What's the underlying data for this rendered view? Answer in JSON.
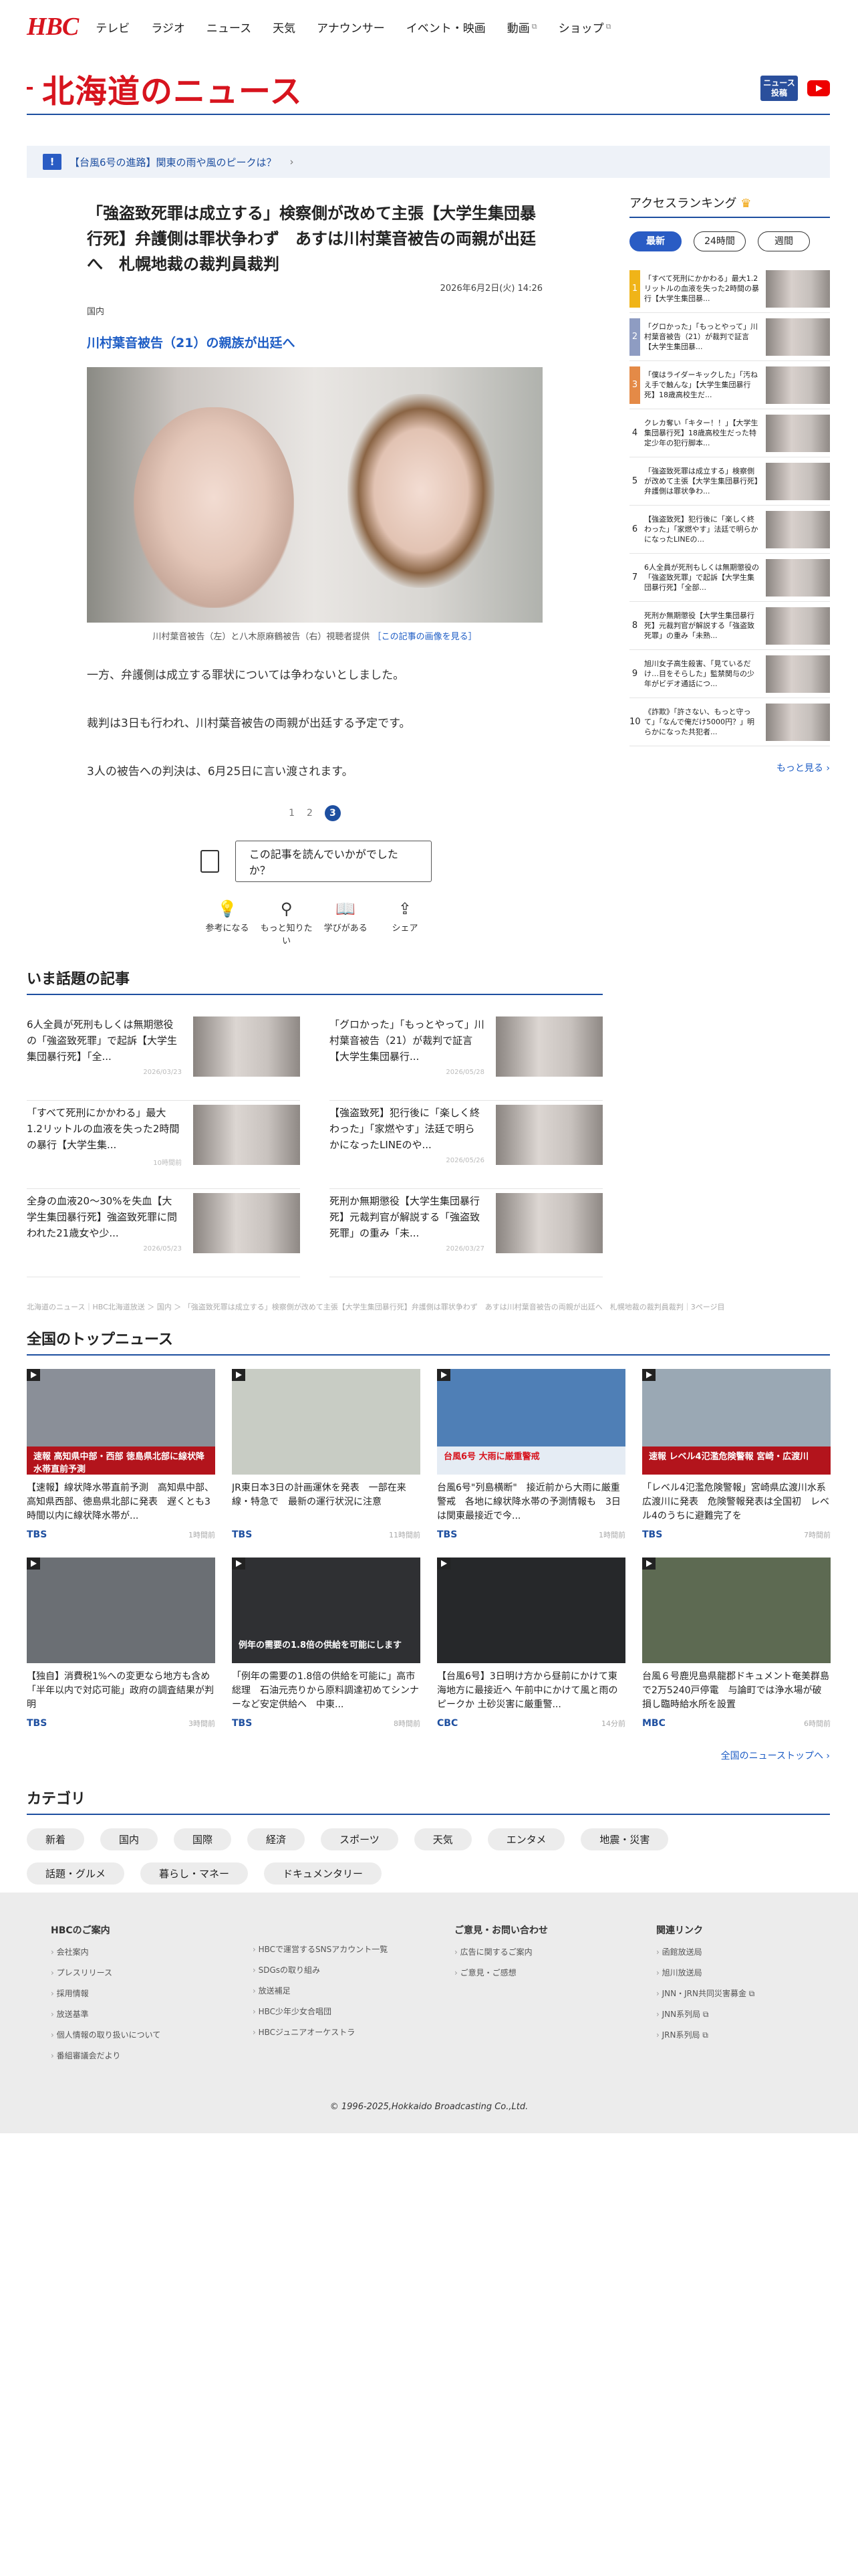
{
  "header": {
    "logo": "HBC",
    "nav": [
      {
        "label": "テレビ",
        "ext": false
      },
      {
        "label": "ラジオ",
        "ext": false
      },
      {
        "label": "ニュース",
        "ext": false
      },
      {
        "label": "天気",
        "ext": false
      },
      {
        "label": "アナウンサー",
        "ext": false
      },
      {
        "label": "イベント・映画",
        "ext": false
      },
      {
        "label": "動画",
        "ext": true
      },
      {
        "label": "ショップ",
        "ext": true
      }
    ],
    "section_title": "北海道のニュース",
    "post_button": "ニュース投稿"
  },
  "alert": {
    "text": "【台風6号の進路】関東の雨や風のピークは？"
  },
  "article": {
    "title": "「強盗致死罪は成立する」検察側が改めて主張【大学生集団暴行死】弁護側は罪状争わず　あすは川村葉音被告の両親が出廷へ　札幌地裁の裁判員裁判",
    "date": "2026年6月2日(火) 14:26",
    "category": "国内",
    "subheading": "川村葉音被告（21）の親族が出廷へ",
    "caption_text": "川村葉音被告（左）と八木原麻鶴被告（右）視聴者提供",
    "caption_link": "［この記事の画像を見る］",
    "paragraphs": [
      "一方、弁護側は成立する罪状については争わないとしました。",
      "裁判は3日も行われ、川村葉音被告の両親が出廷する予定です。",
      "3人の被告への判決は、6月25日に言い渡されます。"
    ],
    "pages": [
      "1",
      "2",
      "3"
    ],
    "current_page": "3"
  },
  "survey": {
    "question": "この記事を読んでいかがでしたか？",
    "reactions": [
      {
        "label": "参考になる",
        "icon": "lightbulb-icon",
        "glyph": "💡"
      },
      {
        "label": "もっと知りたい",
        "icon": "magnifier-icon",
        "glyph": "⚲"
      },
      {
        "label": "学びがある",
        "icon": "book-icon",
        "glyph": "📖"
      },
      {
        "label": "シェア",
        "icon": "share-icon",
        "glyph": "⇪"
      }
    ]
  },
  "ranking": {
    "title": "アクセスランキング",
    "crown": "♛",
    "tabs": [
      "最新",
      "24時間",
      "週間"
    ],
    "items": [
      {
        "rank": "1",
        "text": "「すべて死刑にかかわる」最大1.2リットルの血液を失った2時間の暴行【大学生集団暴..."
      },
      {
        "rank": "2",
        "text": "「グロかった」「もっとやって」川村葉音被告（21）が裁判で証言【大学生集団暴..."
      },
      {
        "rank": "3",
        "text": "「僕はライダーキックした」「汚ねえ手で触んな」【大学生集団暴行死】18歳高校生だ..."
      },
      {
        "rank": "4",
        "text": "クレカ奪い「キター！！」【大学生集団暴行死】18歳高校生だった特定少年の犯行脚本..."
      },
      {
        "rank": "5",
        "text": "「強盗致死罪は成立する」検察側が改めて主張【大学生集団暴行死】弁護側は罪状争わ..."
      },
      {
        "rank": "6",
        "text": "【強盗致死】犯行後に「楽しく終わった」「家燃やす」法廷で明らかになったLINEの..."
      },
      {
        "rank": "7",
        "text": "6人全員が死刑もしくは無期懲役の「強盗致死罪」で起訴【大学生集団暴行死】「全部..."
      },
      {
        "rank": "8",
        "text": "死刑か無期懲役【大学生集団暴行死】元裁判官が解説する「強盗致死罪」の重み「未熟..."
      },
      {
        "rank": "9",
        "text": "旭川女子高生殺害、「見ているだけ…目をそらした」監禁関与の少年がビデオ通話につ..."
      },
      {
        "rank": "10",
        "text": "《詐欺》「許さない、もっと守って」「なんで俺だけ5000円？」明らかになった共犯者..."
      }
    ],
    "more": "もっと見る ›"
  },
  "hot": {
    "title": "いま話題の記事",
    "items": [
      {
        "text": "6人全員が死刑もしくは無期懲役の「強盗致死罪」で起訴【大学生集団暴行死】「全...",
        "time": "2026/03/23"
      },
      {
        "text": "「グロかった」「もっとやって」川村葉音被告（21）が裁判で証言【大学生集団暴行...",
        "time": "2026/05/28"
      },
      {
        "text": "「すべて死刑にかかわる」最大1.2リットルの血液を失った2時間の暴行【大学生集...",
        "time": "10時間前"
      },
      {
        "text": "【強盗致死】犯行後に「楽しく終わった」「家燃やす」法廷で明らかになったLINEのや...",
        "time": "2026/05/26"
      },
      {
        "text": "全身の血液20～30%を失血【大学生集団暴行死】強盗致死罪に問われた21歳女や少...",
        "time": "2026/05/23"
      },
      {
        "text": "死刑か無期懲役【大学生集団暴行死】元裁判官が解説する「強盗致死罪」の重み「未...",
        "time": "2026/03/27"
      }
    ]
  },
  "breadcrumb": "北海道のニュース｜HBC北海道放送 ＞ 国内 ＞ 「強盗致死罪は成立する」検察側が改めて主張【大学生集団暴行死】弁護側は罪状争わず　あすは川村葉音被告の両親が出廷へ　札幌地裁の裁判員裁判｜3ページ目",
  "national": {
    "title": "全国のトップニュース",
    "items": [
      {
        "text": "【速報】線状降水帯直前予測　高知県中部、高知県西部、徳島県北部に発表　遅くとも3時間以内に線状降水帯が...",
        "source": "TBS",
        "time": "1時間前",
        "band": "速報 高知県中部・西部 徳島県北部に線状降水帯直前予測",
        "band_color": "#b3141c",
        "bg": "#8a8f98"
      },
      {
        "text": "JR東日本3日の計画運休を発表　一部在来線・特急で　最新の運行状況に注意",
        "source": "TBS",
        "time": "11時間前",
        "band": "",
        "band_color": "",
        "bg": "#c8ccc4"
      },
      {
        "text": "台風6号\"列島横断\"　接近前から大雨に厳重警戒　各地に線状降水帯の予測情報も　3日は関東最接近で今...",
        "source": "TBS",
        "time": "1時間前",
        "band": "台風6号 大雨に厳重警戒",
        "band_color": "#ffffff",
        "bg": "#4f7fb6"
      },
      {
        "text": "「レベル4氾濫危険警報」宮崎県広渡川水系広渡川に発表　危険警報発表は全国初　レベル4のうちに避難完了を",
        "source": "TBS",
        "time": "7時間前",
        "band": "速報 レベル4氾濫危険警報 宮崎・広渡川",
        "band_color": "#b3141c",
        "bg": "#9aa8b4"
      },
      {
        "text": "【独自】消費税1%への変更なら地方も含め「半年以内で対応可能」政府の調査結果が判明",
        "source": "TBS",
        "time": "3時間前",
        "band": "",
        "band_color": "",
        "bg": "#6b6f74"
      },
      {
        "text": "「例年の需要の1.8倍の供給を可能に」高市総理　石油元売りから原料調達初めてシンナーなど安定供給へ　中東...",
        "source": "TBS",
        "time": "8時間前",
        "band": "例年の需要の1.8倍の供給を可能にします",
        "band_color": "transparent",
        "bg": "#2f3033"
      },
      {
        "text": "【台風6号】3日明け方から昼前にかけて東海地方に最接近へ 午前中にかけて風と雨のピークか 土砂災害に厳重警...",
        "source": "CBC",
        "time": "14分前",
        "band": "",
        "band_color": "",
        "bg": "#26282a"
      },
      {
        "text": "台風６号鹿児島県龍郡ドキュメント奄美群島で2万5240戸停電　与論町では浄水場が破損し臨時給水所を設置",
        "source": "MBC",
        "time": "6時間前",
        "band": "",
        "band_color": "",
        "bg": "#5d6a52"
      }
    ],
    "more": "全国のニューストップへ ›"
  },
  "categories": {
    "title": "カテゴリ",
    "items": [
      "新着",
      "国内",
      "国際",
      "経済",
      "スポーツ",
      "天気",
      "エンタメ",
      "地震・災害",
      "話題・グルメ",
      "暮らし・マネー",
      "ドキュメンタリー"
    ]
  },
  "footer": {
    "columns": [
      {
        "heading": "HBCのご案内",
        "links": [
          "会社案内",
          "プレスリリース",
          "採用情報",
          "放送基準",
          "個人情報の取り扱いについて",
          "番組審議会だより"
        ]
      },
      {
        "heading": "",
        "links": [
          "HBCで運営するSNSアカウント一覧",
          "SDGsの取り組み",
          "放送補足",
          "HBC少年少女合唱団",
          "HBCジュニアオーケストラ"
        ]
      },
      {
        "heading": "ご意見・お問い合わせ",
        "links": [
          "広告に関するご案内",
          "ご意見・ご感想"
        ]
      },
      {
        "heading": "関連リンク",
        "links": [
          "函館放送局",
          "旭川放送局",
          "JNN・JRN共同災害募金 ⧉",
          "JNN系列局 ⧉",
          "JRN系列局 ⧉"
        ]
      }
    ],
    "copyright": "© 1996-2025,Hokkaido Broadcasting Co.,Ltd."
  },
  "colors": {
    "brand_red": "#d7141e",
    "accent_blue": "#1e4fa0",
    "link_blue": "#1e5dc5"
  }
}
